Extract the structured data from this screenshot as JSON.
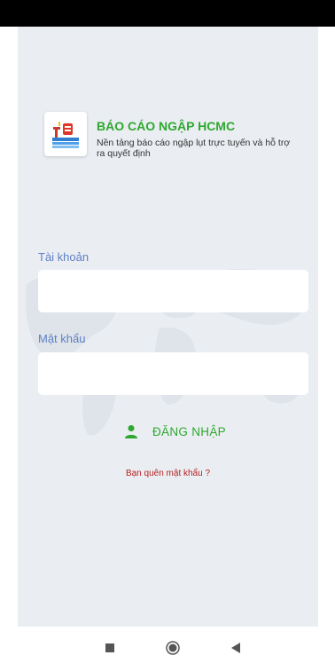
{
  "app": {
    "title": "BÁO CÁO NGẬP HCMC",
    "subtitle": "Nền tảng báo cáo ngập lụt trực tuyến và hỗ trợ ra quyết định",
    "logo_icon": "flood-report-logo-icon"
  },
  "form": {
    "username_label": "Tài khoản",
    "username_value": "",
    "password_label": "Mật khẩu",
    "password_value": "",
    "login_label": "ĐĂNG NHẬP",
    "login_icon": "person-icon",
    "forgot_label": "Bạn quên mật khẩu ?"
  },
  "nav": {
    "recent_icon": "square-icon",
    "home_icon": "circle-icon",
    "back_icon": "triangle-back-icon"
  },
  "colors": {
    "brand_green": "#2ea82e",
    "label_blue": "#5f7fc7",
    "link_red": "#b52020",
    "screen_bg": "#eaeef2"
  }
}
